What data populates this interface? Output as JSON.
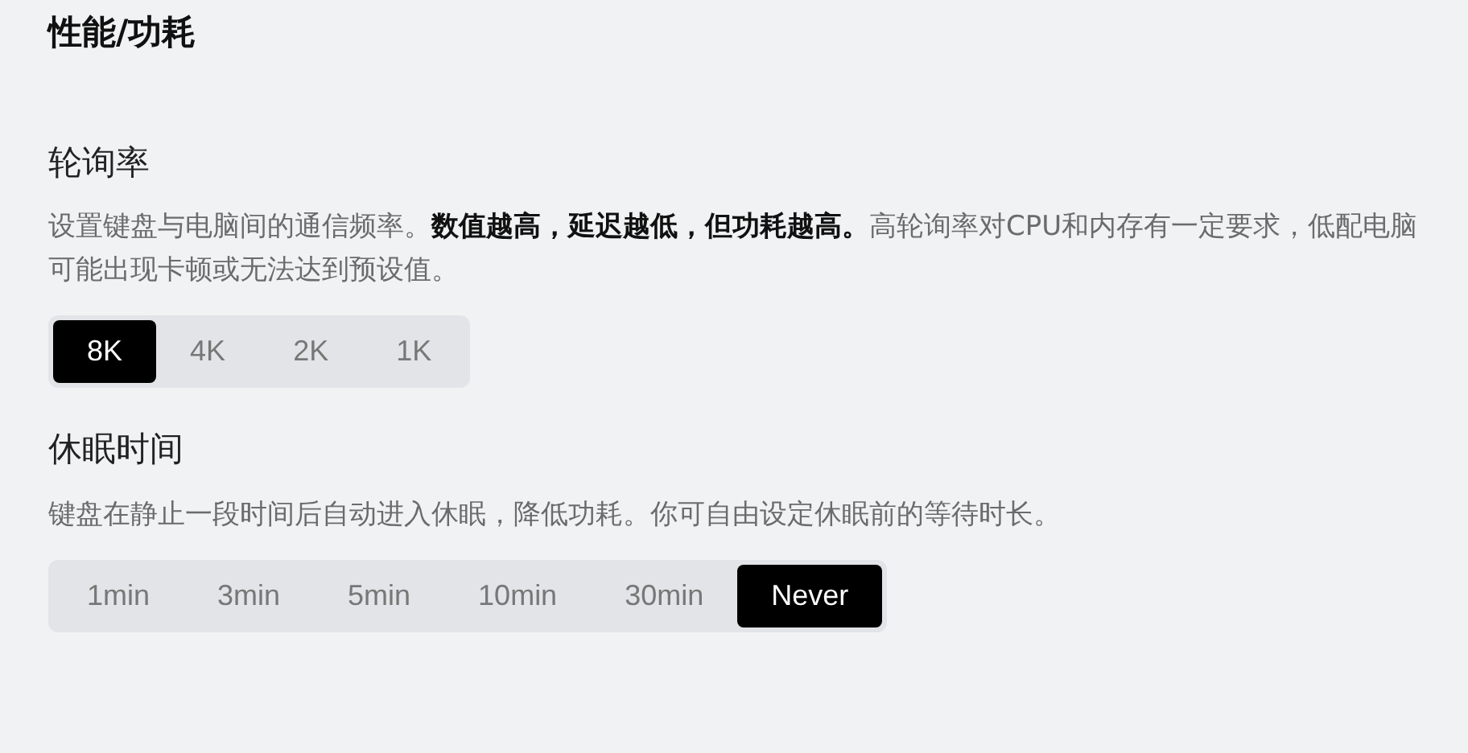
{
  "title": "性能/功耗",
  "sections": [
    {
      "heading": "轮询率",
      "description": "设置键盘与电脑间的通信频率。**数值越高，延迟越低，但功耗越高。**高轮询率对CPU和内存有一定要求，低配电脑可能出现卡顿或无法达到预设值。",
      "options": [
        {
          "label": "8K",
          "selected": true
        },
        {
          "label": "4K",
          "selected": false
        },
        {
          "label": "2K",
          "selected": false
        },
        {
          "label": "1K",
          "selected": false
        }
      ]
    },
    {
      "heading": "休眠时间",
      "description": "键盘在静止一段时间后自动进入休眠，降低功耗。你可自由设定休眠前的等待时长。",
      "options": [
        {
          "label": "1min",
          "selected": false
        },
        {
          "label": "3min",
          "selected": false
        },
        {
          "label": "5min",
          "selected": false
        },
        {
          "label": "10min",
          "selected": false
        },
        {
          "label": "30min",
          "selected": false
        },
        {
          "label": "Never",
          "selected": true
        }
      ]
    }
  ]
}
